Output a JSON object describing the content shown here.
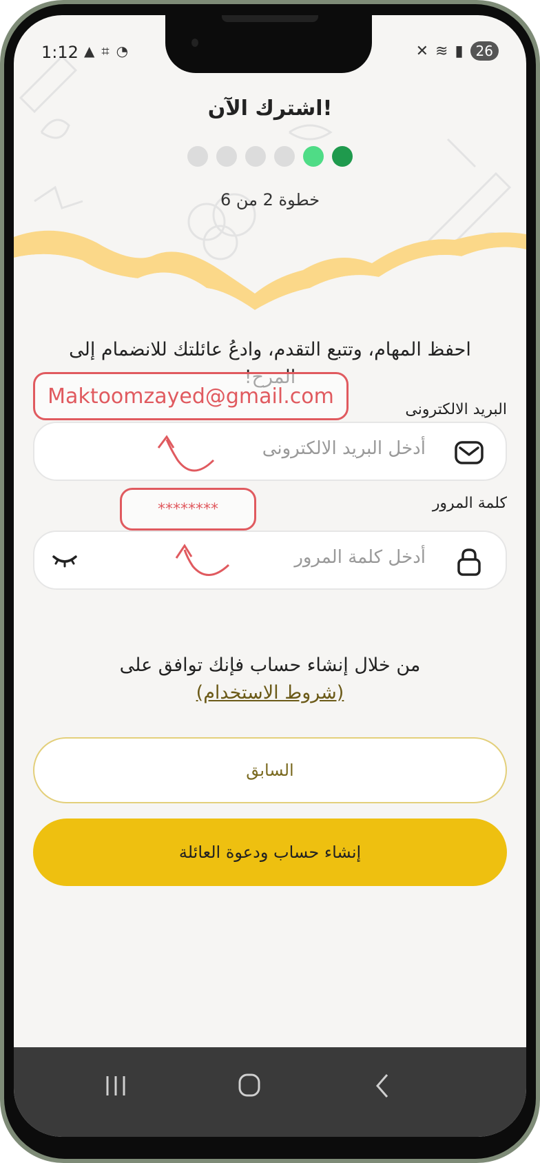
{
  "status_bar": {
    "time": "1:12",
    "battery": "26"
  },
  "header": {
    "title": "اشترك الآن!",
    "step_text": "خطوة 2 من 6",
    "progress": {
      "total_steps": 6,
      "completed_steps": 2,
      "active_color": "#1f9a4d",
      "current_color": "#4fdc86",
      "inactive_color": "#dcdcdc"
    }
  },
  "form": {
    "intro": "احفظ المهام، وتتبع التقدم، وادعُ عائلتك للانضمام إلى المرح!",
    "email_label": "البريد الالكترونى",
    "email_placeholder": "أدخل البريد الالكترونى",
    "password_label": "كلمة المرور",
    "password_placeholder": "أدخل كلمة المرور"
  },
  "annotations": {
    "email_value": "Maktoomzayed@gmail.com",
    "password_value": "********",
    "color": "#e05a5f"
  },
  "terms": {
    "text": "من خلال إنشاء حساب فإنك توافق على",
    "link": "(شروط الاستخدام)"
  },
  "buttons": {
    "previous": "السابق",
    "create": "إنشاء حساب ودعوة العائلة",
    "accent": "#eec010"
  },
  "icons": {
    "email": "envelope-icon",
    "password": "lock-icon",
    "visibility": "eye-closed-icon"
  }
}
